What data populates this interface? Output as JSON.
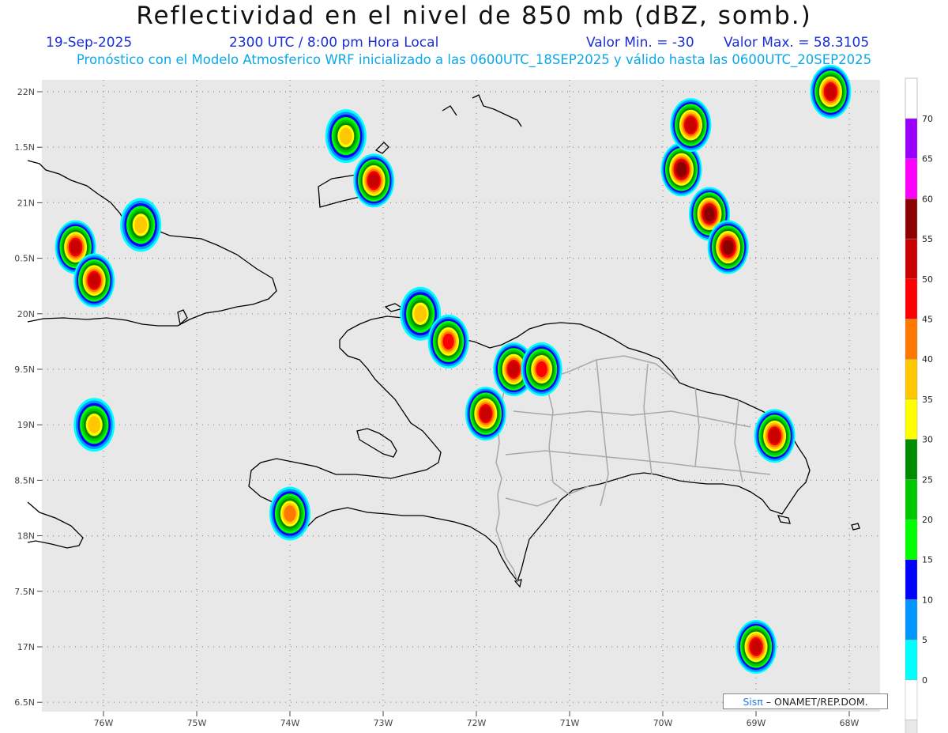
{
  "header": {
    "title": "Reflectividad en el nivel de 850 mb (dBZ, somb.)",
    "date": "19-Sep-2025",
    "time": "2300 UTC / 8:00 pm Hora Local",
    "min_label": "Valor Min. = -30",
    "max_label": "Valor Max. = 58.3105",
    "forecast_line": "Pronóstico con el Modelo Atmosferico WRF inicializado a las 0600UTC_18SEP2025 y válido hasta las  0600UTC_20SEP2025"
  },
  "axes": {
    "lat_labels": [
      "22N",
      "1.5N",
      "21N",
      "0.5N",
      "20N",
      "9.5N",
      "19N",
      "8.5N",
      "18N",
      "7.5N",
      "17N",
      "6.5N"
    ],
    "lon_labels": [
      "76W",
      "75W",
      "74W",
      "73W",
      "72W",
      "71W",
      "70W",
      "69W",
      "68W"
    ]
  },
  "colorbar": {
    "labels": [
      "70",
      "65",
      "60",
      "55",
      "50",
      "45",
      "40",
      "35",
      "30",
      "25",
      "20",
      "15",
      "10",
      "5",
      "0"
    ],
    "colors": [
      "#9b00ff",
      "#ff00ff",
      "#8b0000",
      "#c80000",
      "#ff0000",
      "#ff7800",
      "#ffc800",
      "#ffff00",
      "#008c00",
      "#00c800",
      "#00ff00",
      "#0000ff",
      "#0096ff",
      "#00ffff",
      "#ffffff",
      "#e8e8e8"
    ]
  },
  "credit": {
    "brand": "Sisπ",
    "text": " – ONAMET/REP.DOM."
  },
  "cells": [
    {
      "lon": -76.3,
      "lat": 20.6,
      "max": 55
    },
    {
      "lon": -76.1,
      "lat": 20.3,
      "max": 55
    },
    {
      "lon": -75.6,
      "lat": 20.8,
      "max": 40
    },
    {
      "lon": -73.4,
      "lat": 21.6,
      "max": 40
    },
    {
      "lon": -73.1,
      "lat": 21.2,
      "max": 55
    },
    {
      "lon": -72.6,
      "lat": 20.0,
      "max": 40
    },
    {
      "lon": -72.3,
      "lat": 19.75,
      "max": 50
    },
    {
      "lon": -71.6,
      "lat": 19.5,
      "max": 55
    },
    {
      "lon": -71.9,
      "lat": 19.1,
      "max": 55
    },
    {
      "lon": -71.3,
      "lat": 19.5,
      "max": 50
    },
    {
      "lon": -69.8,
      "lat": 21.3,
      "max": 60
    },
    {
      "lon": -69.7,
      "lat": 21.7,
      "max": 55
    },
    {
      "lon": -69.5,
      "lat": 20.9,
      "max": 60
    },
    {
      "lon": -69.3,
      "lat": 20.6,
      "max": 60
    },
    {
      "lon": -68.8,
      "lat": 18.9,
      "max": 55
    },
    {
      "lon": -69.0,
      "lat": 17.0,
      "max": 55
    },
    {
      "lon": -74.0,
      "lat": 18.2,
      "max": 45
    },
    {
      "lon": -76.1,
      "lat": 19.0,
      "max": 40
    },
    {
      "lon": -68.2,
      "lat": 22.0,
      "max": 55
    }
  ]
}
